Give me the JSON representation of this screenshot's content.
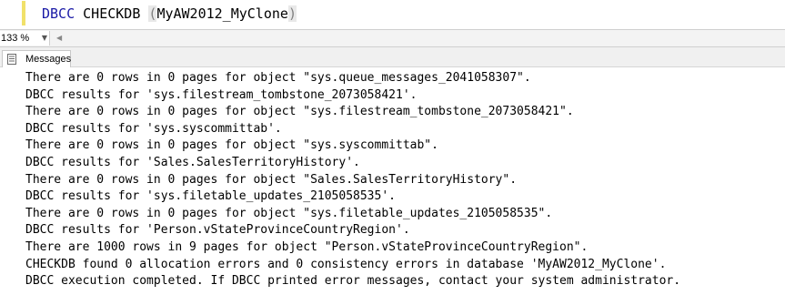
{
  "editor": {
    "keyword1": "DBCC",
    "keyword2": "CHECKDB",
    "open_paren": "(",
    "argument": "MyAW2012_MyClone",
    "close_paren": ")"
  },
  "zoom": {
    "value": "133 %"
  },
  "results": {
    "tab_label": "Messages",
    "lines": [
      "There are 0 rows in 0 pages for object \"sys.queue_messages_2041058307\".",
      "DBCC results for 'sys.filestream_tombstone_2073058421'.",
      "There are 0 rows in 0 pages for object \"sys.filestream_tombstone_2073058421\".",
      "DBCC results for 'sys.syscommittab'.",
      "There are 0 rows in 0 pages for object \"sys.syscommittab\".",
      "DBCC results for 'Sales.SalesTerritoryHistory'.",
      "There are 0 rows in 0 pages for object \"Sales.SalesTerritoryHistory\".",
      "DBCC results for 'sys.filetable_updates_2105058535'.",
      "There are 0 rows in 0 pages for object \"sys.filetable_updates_2105058535\".",
      "DBCC results for 'Person.vStateProvinceCountryRegion'.",
      "There are 1000 rows in 9 pages for object \"Person.vStateProvinceCountryRegion\".",
      "CHECKDB found 0 allocation errors and 0 consistency errors in database 'MyAW2012_MyClone'.",
      "DBCC execution completed. If DBCC printed error messages, contact your system administrator."
    ]
  },
  "icons": {
    "messages_tab": "messages-document-icon",
    "zoom_dropdown": "chevron-down-icon",
    "scroll_left": "scroll-left-icon"
  },
  "colors": {
    "keyword": "#1a1aa6",
    "paren": "#808080",
    "margin_marker": "#f1e16a"
  }
}
